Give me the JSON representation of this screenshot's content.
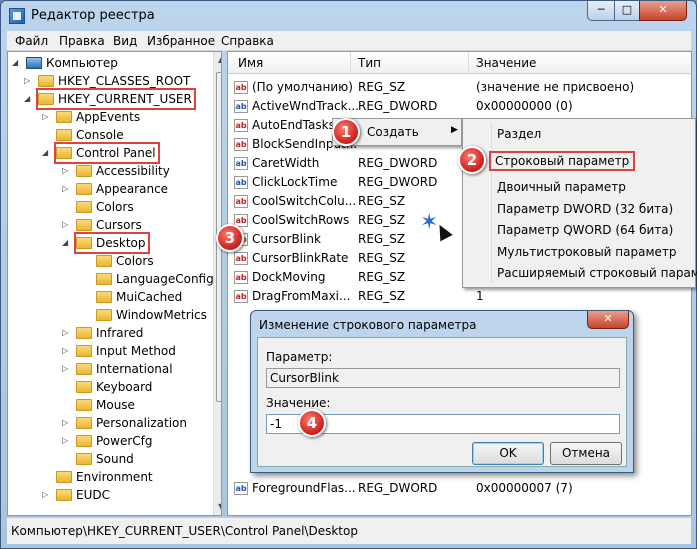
{
  "window": {
    "title": "Редактор реестра",
    "min": "─",
    "max": "□",
    "close": "✕"
  },
  "menu": [
    "Файл",
    "Правка",
    "Вид",
    "Избранное",
    "Справка"
  ],
  "tree": [
    {
      "label": "Компьютер"
    },
    {
      "label": "HKEY_CLASSES_ROOT"
    },
    {
      "label": "HKEY_CURRENT_USER"
    },
    {
      "label": "AppEvents"
    },
    {
      "label": "Console"
    },
    {
      "label": "Control Panel"
    },
    {
      "label": "Accessibility"
    },
    {
      "label": "Appearance"
    },
    {
      "label": "Colors"
    },
    {
      "label": "Cursors"
    },
    {
      "label": "Desktop"
    },
    {
      "label": "Colors"
    },
    {
      "label": "LanguageConfig"
    },
    {
      "label": "MuiCached"
    },
    {
      "label": "WindowMetrics"
    },
    {
      "label": "Infrared"
    },
    {
      "label": "Input Method"
    },
    {
      "label": "International"
    },
    {
      "label": "Keyboard"
    },
    {
      "label": "Mouse"
    },
    {
      "label": "Personalization"
    },
    {
      "label": "PowerCfg"
    },
    {
      "label": "Sound"
    },
    {
      "label": "Environment"
    },
    {
      "label": "EUDC"
    }
  ],
  "columns": {
    "name": "Имя",
    "type": "Тип",
    "value": "Значение"
  },
  "rows": [
    {
      "icon": "ab",
      "name": "(По умолчанию)",
      "type": "REG_SZ",
      "value": "(значение не присвоено)"
    },
    {
      "icon": "ab",
      "name": "ActiveWndTrack...",
      "type": "REG_DWORD",
      "value": "0x00000000 (0)"
    },
    {
      "icon": "ab",
      "name": "AutoEndTasks",
      "type": "",
      "value": ""
    },
    {
      "icon": "ab",
      "name": "BlockSendInput...",
      "type": "",
      "value": ""
    },
    {
      "icon": "ab",
      "name": "CaretWidth",
      "type": "REG_DWORD",
      "value": ""
    },
    {
      "icon": "ab",
      "name": "ClickLockTime",
      "type": "REG_DWORD",
      "value": ""
    },
    {
      "icon": "ab",
      "name": "CoolSwitchColu...",
      "type": "REG_SZ",
      "value": ""
    },
    {
      "icon": "ab",
      "name": "CoolSwitchRows",
      "type": "REG_SZ",
      "value": ""
    },
    {
      "icon": "ab",
      "name": "CursorBlink",
      "type": "REG_SZ",
      "value": ""
    },
    {
      "icon": "ab",
      "name": "CursorBlinkRate",
      "type": "REG_SZ",
      "value": ""
    },
    {
      "icon": "ab",
      "name": "DockMoving",
      "type": "REG_SZ",
      "value": ""
    },
    {
      "icon": "ab",
      "name": "DragFromMaxi...",
      "type": "REG_SZ",
      "value": "1"
    },
    {
      "icon": "ab",
      "name": "ForegroundFlas...",
      "type": "REG_DWORD",
      "value": "0x00000007 (7)"
    }
  ],
  "context_menu": {
    "create": "Создать"
  },
  "submenu": [
    "Раздел",
    "Строковый параметр",
    "Двоичный параметр",
    "Параметр DWORD (32 бита)",
    "Параметр QWORD (64 бита)",
    "Мультистроковый параметр",
    "Расширяемый строковый параметр"
  ],
  "dialog": {
    "title": "Изменение строкового параметра",
    "param_label": "Параметр:",
    "param_value": "CursorBlink",
    "value_label": "Значение:",
    "value_input": "-1",
    "ok": "OK",
    "cancel": "Отмена",
    "close": "✕"
  },
  "status_path": "Компьютер\\HKEY_CURRENT_USER\\Control Panel\\Desktop",
  "badges": [
    "1",
    "2",
    "3",
    "4"
  ],
  "colors": {
    "highlight": "#e04040",
    "badge": "#c81e1e"
  }
}
